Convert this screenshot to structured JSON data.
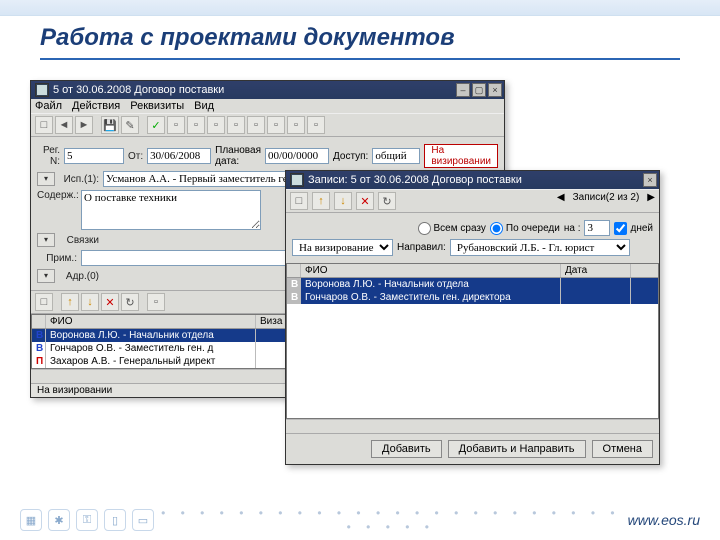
{
  "page_title": "Работа с проектами документов",
  "footer_url": "www.eos.ru",
  "win1": {
    "title": "5 от 30.06.2008 Договор поставки",
    "menu": [
      "Файл",
      "Действия",
      "Реквизиты",
      "Вид"
    ],
    "labels": {
      "reg": "Рег. N:",
      "ot": "От:",
      "plan": "Плановая дата:",
      "access": "Доступ:",
      "isp": "Исп.(1):",
      "sod": "Содерж.:",
      "sv": "Связки",
      "prim": "Прим.:",
      "adr": "Адр.(0)"
    },
    "fields": {
      "reg_n": "5",
      "ot": "30/06/2008",
      "plan": "00/00/0000",
      "access": "общий",
      "isp": "Усманов А.А. - Первый заместитель ген. директора",
      "sod": "О поставке техники"
    },
    "status": "На визировании",
    "grid": {
      "cols": [
        "",
        "ФИО",
        "Виза \\ подпись"
      ],
      "rows": [
        {
          "m": "В",
          "mclass": "blue",
          "fio": "Воронова Л.Ю. - Начальник отдела",
          "viza": "",
          "sel": true
        },
        {
          "m": "В",
          "mclass": "blue",
          "fio": "Гончаров О.В. - Заместитель ген. д",
          "viza": ""
        },
        {
          "m": "П",
          "mclass": "red",
          "fio": "Захаров А.В. - Генеральный директ",
          "viza": ""
        }
      ]
    },
    "statusbar": "На визировании"
  },
  "win2": {
    "title": "Записи: 5 от 30.06.2008 Договор поставки",
    "records_label": "Записи(2 из 2)",
    "radio1": "Всем сразу",
    "radio2": "По очереди",
    "na": "на :",
    "na_val": "3",
    "days": "дней",
    "stage_label": "На визирование",
    "napravil_label": "Направил:",
    "napravil": "Рубановский Л.Б. - Гл. юрист",
    "grid": {
      "cols": [
        "",
        "ФИО",
        "Дата"
      ],
      "rows": [
        {
          "m": "В",
          "fio": "Воронова Л.Ю. - Начальник отдела",
          "date": ""
        },
        {
          "m": "В",
          "fio": "Гончаров О.В. - Заместитель ген. директора",
          "date": ""
        }
      ]
    },
    "buttons": {
      "add": "Добавить",
      "addsend": "Добавить и Направить",
      "cancel": "Отмена"
    }
  }
}
